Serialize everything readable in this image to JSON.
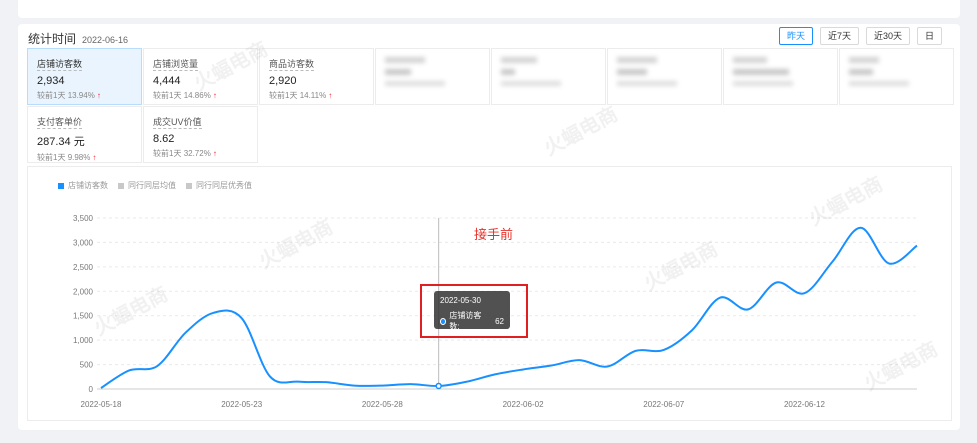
{
  "header": {
    "title": "统计时间",
    "date": "2022-06-16",
    "range_buttons": [
      {
        "label": "昨天",
        "active": true
      },
      {
        "label": "近7天",
        "active": false
      },
      {
        "label": "近30天",
        "active": false
      },
      {
        "label": "日",
        "active": false
      }
    ]
  },
  "metrics": [
    {
      "name": "店铺访客数",
      "value": "2,934",
      "compare_label": "较前1天",
      "compare_value": "13.94%",
      "trend": "up",
      "active": true
    },
    {
      "name": "店铺浏览量",
      "value": "4,444",
      "compare_label": "较前1天",
      "compare_value": "14.86%",
      "trend": "up",
      "active": false
    },
    {
      "name": "商品访客数",
      "value": "2,920",
      "compare_label": "较前1天",
      "compare_value": "14.11%",
      "trend": "up",
      "active": false
    },
    {
      "name": "",
      "value": "",
      "compare_label": "",
      "compare_value": "",
      "trend": "up",
      "blurred": true
    },
    {
      "name": "",
      "value": "",
      "compare_label": "",
      "compare_value": "",
      "trend": "up",
      "blurred": true
    },
    {
      "name": "",
      "value": "",
      "compare_label": "",
      "compare_value": "",
      "trend": "up",
      "blurred": true
    },
    {
      "name": "",
      "value": "",
      "compare_label": "",
      "compare_value": "",
      "trend": "up",
      "blurred": true
    },
    {
      "name": "",
      "value": "",
      "compare_label": "",
      "compare_value": "",
      "trend": "up",
      "blurred": true
    },
    {
      "name": "支付客单价",
      "value": "287.34 元",
      "compare_label": "较前1天",
      "compare_value": "9.98%",
      "trend": "up",
      "active": false
    },
    {
      "name": "成交UV价值",
      "value": "8.62",
      "compare_label": "较前1天",
      "compare_value": "32.72%",
      "trend": "up",
      "active": false
    }
  ],
  "legend": [
    {
      "label": "店铺访客数",
      "color": "#1890ff"
    },
    {
      "label": "同行同层均值",
      "color": "#c8c8c8"
    },
    {
      "label": "同行同层优秀值",
      "color": "#c8c8c8"
    }
  ],
  "annotation_text": "接手前",
  "tooltip": {
    "date": "2022-05-30",
    "series_label": "店铺访客数:",
    "value": "62"
  },
  "watermark": "火蝠电商",
  "colors": {
    "accent": "#1890ff",
    "trend_up": "#f5222d",
    "highlight": "#e02020"
  },
  "chart_data": {
    "type": "line",
    "title": "",
    "xlabel": "",
    "ylabel": "",
    "ylim": [
      0,
      3500
    ],
    "yticks": [
      "0",
      "500",
      "1,000",
      "1,500",
      "2,000",
      "2,500",
      "3,000",
      "3,500"
    ],
    "xticks": [
      "2022-05-18",
      "2022-05-23",
      "2022-05-28",
      "2022-06-02",
      "2022-06-07",
      "2022-06-12"
    ],
    "x": [
      "2022-05-18",
      "2022-05-19",
      "2022-05-20",
      "2022-05-21",
      "2022-05-22",
      "2022-05-23",
      "2022-05-24",
      "2022-05-25",
      "2022-05-26",
      "2022-05-27",
      "2022-05-28",
      "2022-05-29",
      "2022-05-30",
      "2022-05-31",
      "2022-06-01",
      "2022-06-02",
      "2022-06-03",
      "2022-06-04",
      "2022-06-05",
      "2022-06-06",
      "2022-06-07",
      "2022-06-08",
      "2022-06-09",
      "2022-06-10",
      "2022-06-11",
      "2022-06-12",
      "2022-06-13",
      "2022-06-14",
      "2022-06-15",
      "2022-06-16"
    ],
    "series": [
      {
        "name": "店铺访客数",
        "values": [
          20,
          380,
          470,
          1150,
          1560,
          1450,
          260,
          150,
          140,
          70,
          70,
          100,
          62,
          150,
          300,
          400,
          480,
          590,
          460,
          780,
          800,
          1200,
          1870,
          1630,
          2180,
          1960,
          2610,
          3300,
          2570,
          2934
        ]
      }
    ]
  }
}
